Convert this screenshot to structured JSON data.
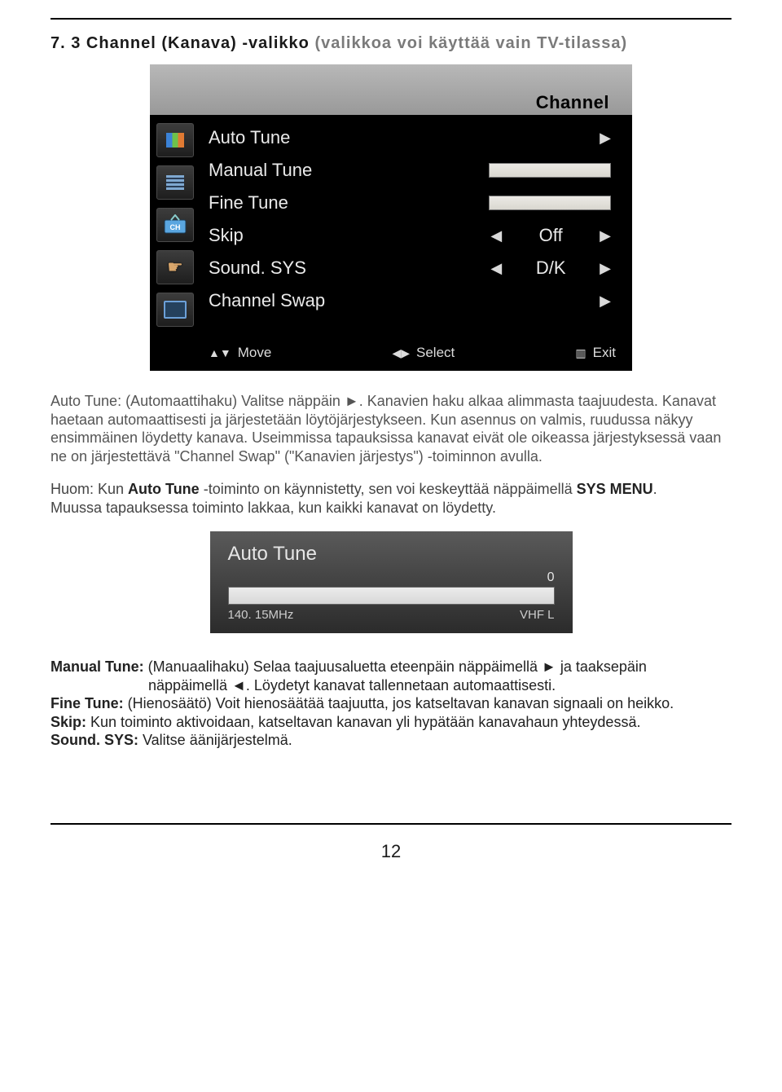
{
  "heading": {
    "num": "7. 3 Channel (Kanava) -valikko",
    "suffix": " (valikkoa voi käyttää vain TV-tilassa)"
  },
  "osd_channel": {
    "title": "Channel",
    "items": {
      "auto_tune": "Auto Tune",
      "manual_tune": "Manual Tune",
      "fine_tune": "Fine Tune",
      "skip": "Skip",
      "skip_val": "Off",
      "sound_sys": "Sound. SYS",
      "sound_val": "D/K",
      "channel_swap": "Channel Swap"
    },
    "footer": {
      "move": "Move",
      "select": "Select",
      "exit": "Exit"
    }
  },
  "para1": "Auto Tune: (Automaattihaku) Valitse näppäin  ►. Kanavien haku alkaa alimmasta taajuudesta. Kanavat haetaan automaattisesti ja järjestetään löytöjärjestykseen. Kun asennus on valmis, ruudussa näkyy ensimmäinen löydetty kanava. Useimmissa tapauksissa kanavat eivät ole oikeassa järjestyksessä vaan ne on järjestettävä \"Channel Swap\" (\"Kanavien järjestys\") -toiminnon avulla.",
  "para1_label": "Auto Tune:",
  "para2_line1_pre": "Huom: Kun ",
  "para2_line1_bold": "Auto Tune",
  "para2_line1_post": " -toiminto on käynnistetty, sen voi keskeyttää näppäimellä ",
  "para2_line1_bold2": "SYS MENU",
  "para2_line1_end": ".",
  "para2_line2": "Muussa tapauksessa toiminto lakkaa, kun kaikki kanavat on löydetty.",
  "osd_autotune": {
    "title": "Auto Tune",
    "count": "0",
    "freq": "140. 15MHz",
    "band": "VHF L"
  },
  "lower": {
    "manual_label": "Manual Tune:",
    "manual_text": " (Manuaalihaku) Selaa taajuusaluetta eteenpäin näppäimellä  ►  ja taaksepäin",
    "manual_line2": "näppäimellä  ◄. Löydetyt kanavat tallennetaan automaattisesti.",
    "fine_label": "Fine Tune:",
    "fine_text": " (Hienosäätö) Voit hienosäätää taajuutta, jos katseltavan kanavan signaali on heikko.",
    "skip_label": "Skip:",
    "skip_text": " Kun toiminto aktivoidaan, katseltavan kanavan yli hypätään kanavahaun yhteydessä.",
    "sound_label": "Sound. SYS:",
    "sound_text": " Valitse äänijärjestelmä."
  },
  "page_number": "12"
}
